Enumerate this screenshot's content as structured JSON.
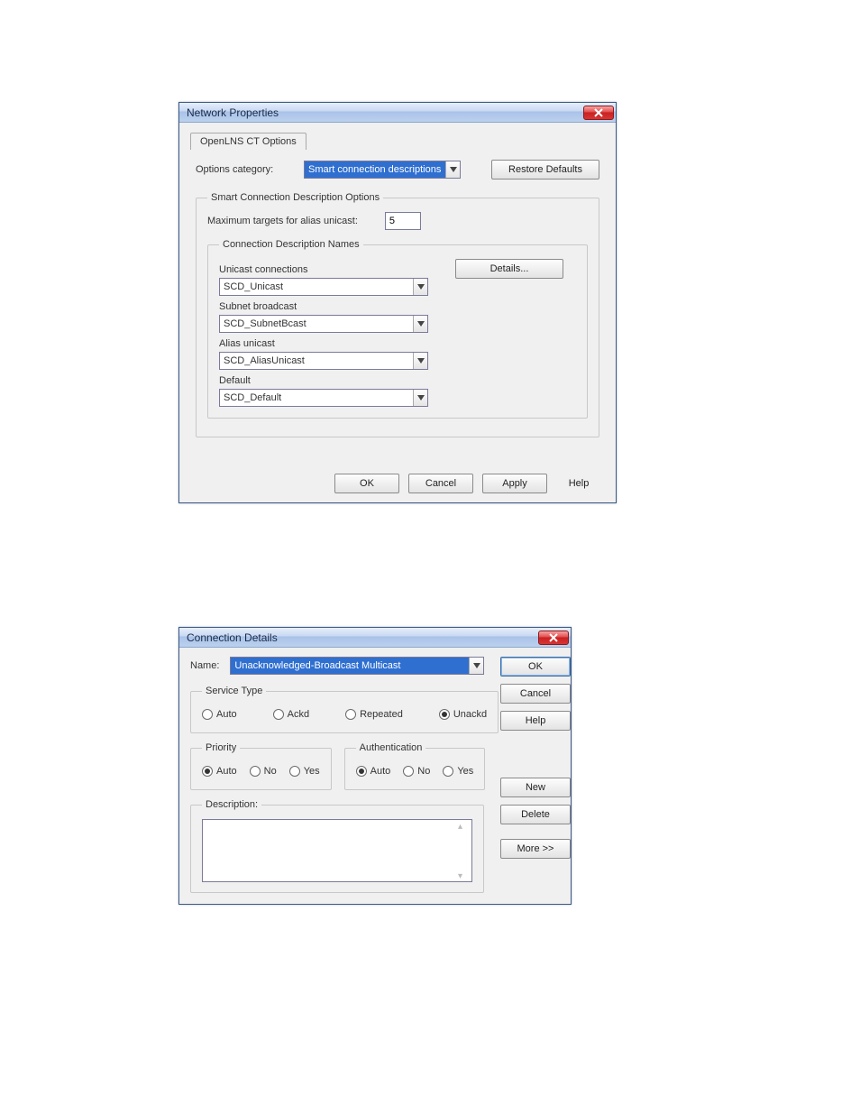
{
  "dlg1": {
    "title": "Network Properties",
    "tab": "OpenLNS CT Options",
    "category_label": "Options category:",
    "category_value": "Smart connection descriptions",
    "restore_btn": "Restore Defaults",
    "outer_legend": "Smart Connection Description Options",
    "max_targets_label": "Maximum targets for alias unicast:",
    "max_targets_value": "5",
    "inner_legend": "Connection Description Names",
    "details_btn": "Details...",
    "fields": [
      {
        "label": "Unicast connections",
        "value": "SCD_Unicast"
      },
      {
        "label": "Subnet broadcast",
        "value": "SCD_SubnetBcast"
      },
      {
        "label": "Alias unicast",
        "value": "SCD_AliasUnicast"
      },
      {
        "label": "Default",
        "value": "SCD_Default"
      }
    ],
    "buttons": {
      "ok": "OK",
      "cancel": "Cancel",
      "apply": "Apply",
      "help": "Help"
    }
  },
  "dlg2": {
    "title": "Connection Details",
    "name_label": "Name:",
    "name_value": "Unacknowledged-Broadcast Multicast",
    "service_legend": "Service Type",
    "service_options": {
      "auto": "Auto",
      "ackd": "Ackd",
      "repeated": "Repeated",
      "unackd": "Unackd"
    },
    "service_selected": "unackd",
    "priority_legend": "Priority",
    "priority_options": {
      "auto": "Auto",
      "no": "No",
      "yes": "Yes"
    },
    "priority_selected": "auto",
    "auth_legend": "Authentication",
    "auth_options": {
      "auto": "Auto",
      "no": "No",
      "yes": "Yes"
    },
    "auth_selected": "auto",
    "desc_legend": "Description:",
    "desc_value": "",
    "side": {
      "ok": "OK",
      "cancel": "Cancel",
      "help": "Help",
      "new": "New",
      "delete": "Delete",
      "more": "More >>"
    }
  }
}
